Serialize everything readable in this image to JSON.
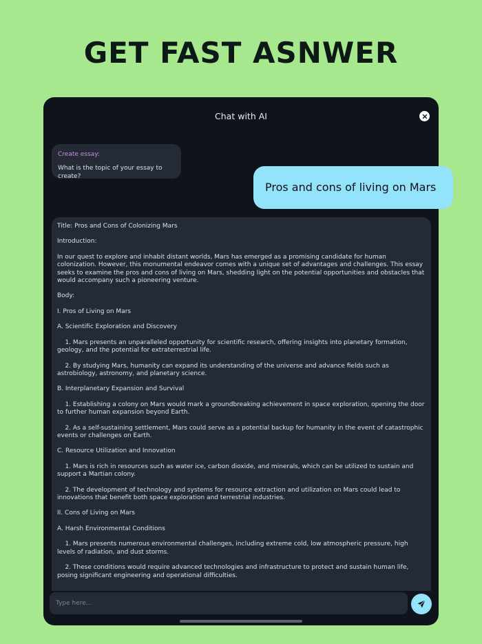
{
  "headline": "GET FAST ASNWER",
  "chat": {
    "title": "Chat with AI",
    "close_icon": "close-icon"
  },
  "prompt_bubble": {
    "label": "Create essay:",
    "question": "What is the topic of your essay to create?"
  },
  "user_message": "Pros and cons of living on Mars",
  "essay": {
    "paragraphs": [
      "Title: Pros and Cons of Colonizing Mars",
      "Introduction:",
      "In our quest to explore and inhabit distant worlds, Mars has emerged as a promising candidate for human colonization. However, this monumental endeavor comes with a unique set of advantages and challenges. This essay seeks to examine the pros and cons of living on Mars, shedding light on the potential opportunities and obstacles that would accompany such a pioneering venture.",
      "Body:",
      "I. Pros of Living on Mars",
      "A. Scientific Exploration and Discovery",
      "    1. Mars presents an unparalleled opportunity for scientific research, offering insights into planetary formation, geology, and the potential for extraterrestrial life.",
      "    2. By studying Mars, humanity can expand its understanding of the universe and advance fields such as astrobiology, astronomy, and planetary science.",
      "B. Interplanetary Expansion and Survival",
      "    1. Establishing a colony on Mars would mark a groundbreaking achievement in space exploration, opening the door to further human expansion beyond Earth.",
      "    2. As a self-sustaining settlement, Mars could serve as a potential backup for humanity in the event of catastrophic events or challenges on Earth.",
      "C. Resource Utilization and Innovation",
      "    1. Mars is rich in resources such as water ice, carbon dioxide, and minerals, which can be utilized to sustain and support a Martian colony.",
      "    2. The development of technology and systems for resource extraction and utilization on Mars could lead to innovations that benefit both space exploration and terrestrial industries.",
      "II. Cons of Living on Mars",
      "A. Harsh Environmental Conditions",
      "    1. Mars presents numerous environmental challenges, including extreme cold, low atmospheric pressure, high levels of radiation, and dust storms.",
      "    2. These conditions would require advanced technologies and infrastructure to protect and sustain human life, posing significant engineering and operational difficulties."
    ]
  },
  "composer": {
    "placeholder": "Type here...",
    "send_icon": "send-icon"
  },
  "colors": {
    "background": "#a7e88f",
    "panel": "#0e131c",
    "bubble": "#252b36",
    "accent": "#93e3fb",
    "label": "#c290e0"
  }
}
